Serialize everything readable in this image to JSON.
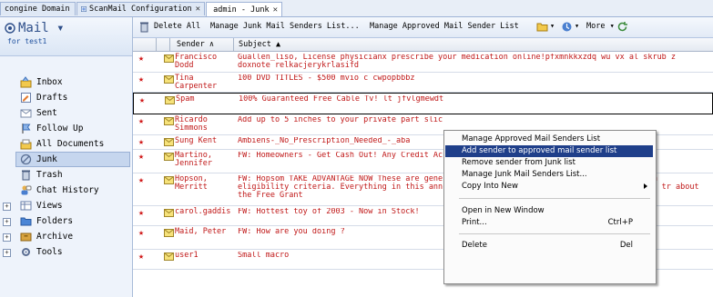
{
  "tabs": [
    {
      "label": "congine Domain",
      "active": false,
      "closable": false
    },
    {
      "label": "ScanMail Configuration",
      "active": false,
      "closable": true,
      "icon": "config-icon"
    },
    {
      "label": "admin - Junk",
      "active": true,
      "closable": true,
      "icon": "folder-icon"
    }
  ],
  "nav": {
    "title": "Mail ▾",
    "user": "for test1",
    "items": [
      {
        "label": "Inbox",
        "icon": "inbox-icon",
        "expander": ""
      },
      {
        "label": "Drafts",
        "icon": "drafts-icon",
        "expander": ""
      },
      {
        "label": "Sent",
        "icon": "sent-icon",
        "expander": ""
      },
      {
        "label": "Follow Up",
        "icon": "follow-up-icon",
        "expander": ""
      },
      {
        "label": "All Documents",
        "icon": "all-documents-icon",
        "expander": ""
      },
      {
        "label": "Junk",
        "icon": "junk-icon",
        "expander": "",
        "selected": true
      },
      {
        "label": "Trash",
        "icon": "trash-icon",
        "expander": ""
      },
      {
        "label": "Chat History",
        "icon": "chat-history-icon",
        "expander": ""
      },
      {
        "label": "Views",
        "icon": "views-icon",
        "expander": "+"
      },
      {
        "label": "Folders",
        "icon": "folders-icon",
        "expander": "+"
      },
      {
        "label": "Archive",
        "icon": "archive-icon",
        "expander": "+"
      },
      {
        "label": "Tools",
        "icon": "tools-icon",
        "expander": "+"
      }
    ]
  },
  "toolbar": {
    "delete_all": "Delete All",
    "manage_junk": "Manage Junk Mail Senders List...",
    "manage_approved": "Manage Approved Mail Sender List",
    "more": "More",
    "more_arrow": "▾"
  },
  "list": {
    "col_sender": "Sender",
    "col_sender_sort": "∧",
    "col_subject": "Subject",
    "col_subject_sort": "▲",
    "rows": [
      {
        "sender": "Francisco Dodd",
        "subject": "Guallen_liso, License physicianx prescribe your medication online!pfxmnkkxzdq wu vx al skrub z doxnote relkacjerykrlasifd",
        "unread": true
      },
      {
        "sender": "Tina Carpenter",
        "subject": "100 DVD TITLES - $500 mvio c cwpopbbbz",
        "unread": true
      },
      {
        "sender": "Spam",
        "subject": "100% Guaranteed Free Cable Tv! lt jfvlgmewdt",
        "unread": true,
        "selected": true
      },
      {
        "sender": "Ricardo Simmons",
        "subject": "Add up to 5 inches to your private part  slic",
        "unread": true
      },
      {
        "sender": "Sung Kent",
        "subject": "Ambiens-_No_Prescription_Needed_-_aba",
        "unread": true
      },
      {
        "sender": "Martino, Jennifer",
        "subject": "FW: Homeowners - Get Cash Out! Any Credit Acc",
        "unread": true
      },
      {
        "sender": "Hopson, Merritt",
        "subject": "FW: Hopsom TAKE ADVANTAGE NOW These are gene                                  dates that m eligibility criteria. Everything in this annc                                  ble, honest tr about the Free Grant",
        "unread": true
      },
      {
        "sender": "carol.gaddis",
        "subject": "FW: Hottest toy of 2003 - Now in Stock!",
        "unread": true
      },
      {
        "sender": "Maid, Peter",
        "subject": "FW: How are you doing ?",
        "unread": true
      },
      {
        "sender": "user1",
        "subject": "Small macro",
        "unread": true
      }
    ]
  },
  "context_menu": {
    "items": [
      {
        "label": "Manage Approved Mail Senders List",
        "shortcut": ""
      },
      {
        "label": "Add sender to approved mail sender list",
        "shortcut": "",
        "highlighted": true
      },
      {
        "label": "Remove sender from Junk list",
        "shortcut": ""
      },
      {
        "label": "Manage Junk Mail Senders List...",
        "shortcut": ""
      },
      {
        "label": "Copy Into New",
        "shortcut": "",
        "submenu": true
      },
      {
        "label": "Open in New Window",
        "shortcut": ""
      },
      {
        "label": "Print...",
        "shortcut": "Ctrl+P"
      },
      {
        "label": "Delete",
        "shortcut": "Del"
      }
    ]
  },
  "colors": {
    "unread_text": "#c01818",
    "highlight": "#1f3f8a",
    "nav_bg": "#eef3fb"
  }
}
